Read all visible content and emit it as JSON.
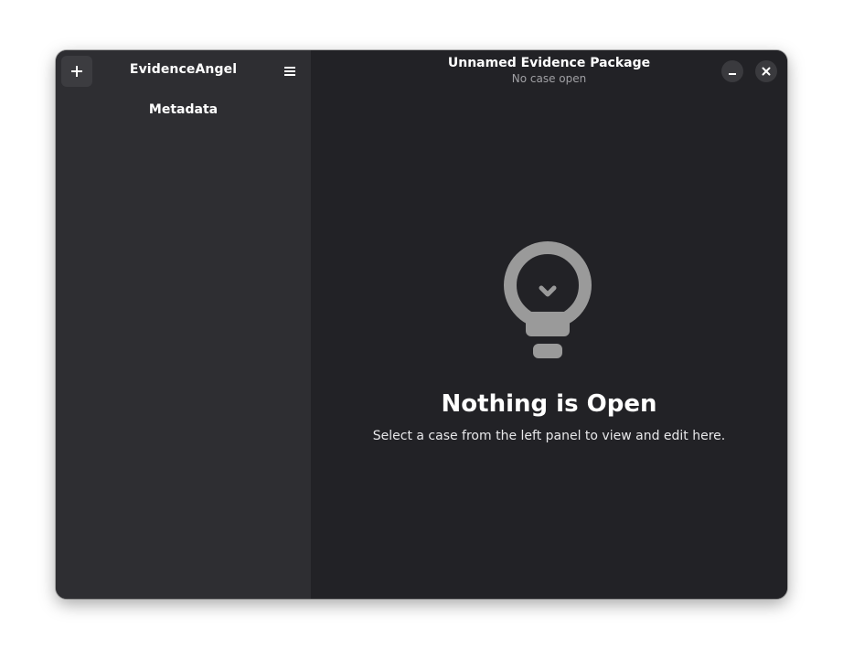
{
  "sidebar": {
    "app_title": "EvidenceAngel",
    "add_button_icon": "plus-icon",
    "menu_button_icon": "hamburger-menu-icon",
    "items": [
      {
        "label": "Metadata"
      }
    ]
  },
  "header": {
    "title": "Unnamed Evidence Package",
    "subtitle": "No case open",
    "minimize_icon": "minimize-icon",
    "close_icon": "close-icon"
  },
  "status": {
    "icon": "lightbulb-icon",
    "title": "Nothing is Open",
    "description": "Select a case from the left panel to view and edit here."
  },
  "colors": {
    "sidebar_bg": "#2e2e32",
    "content_bg": "#222226",
    "icon_gray": "#9a9a9a"
  }
}
